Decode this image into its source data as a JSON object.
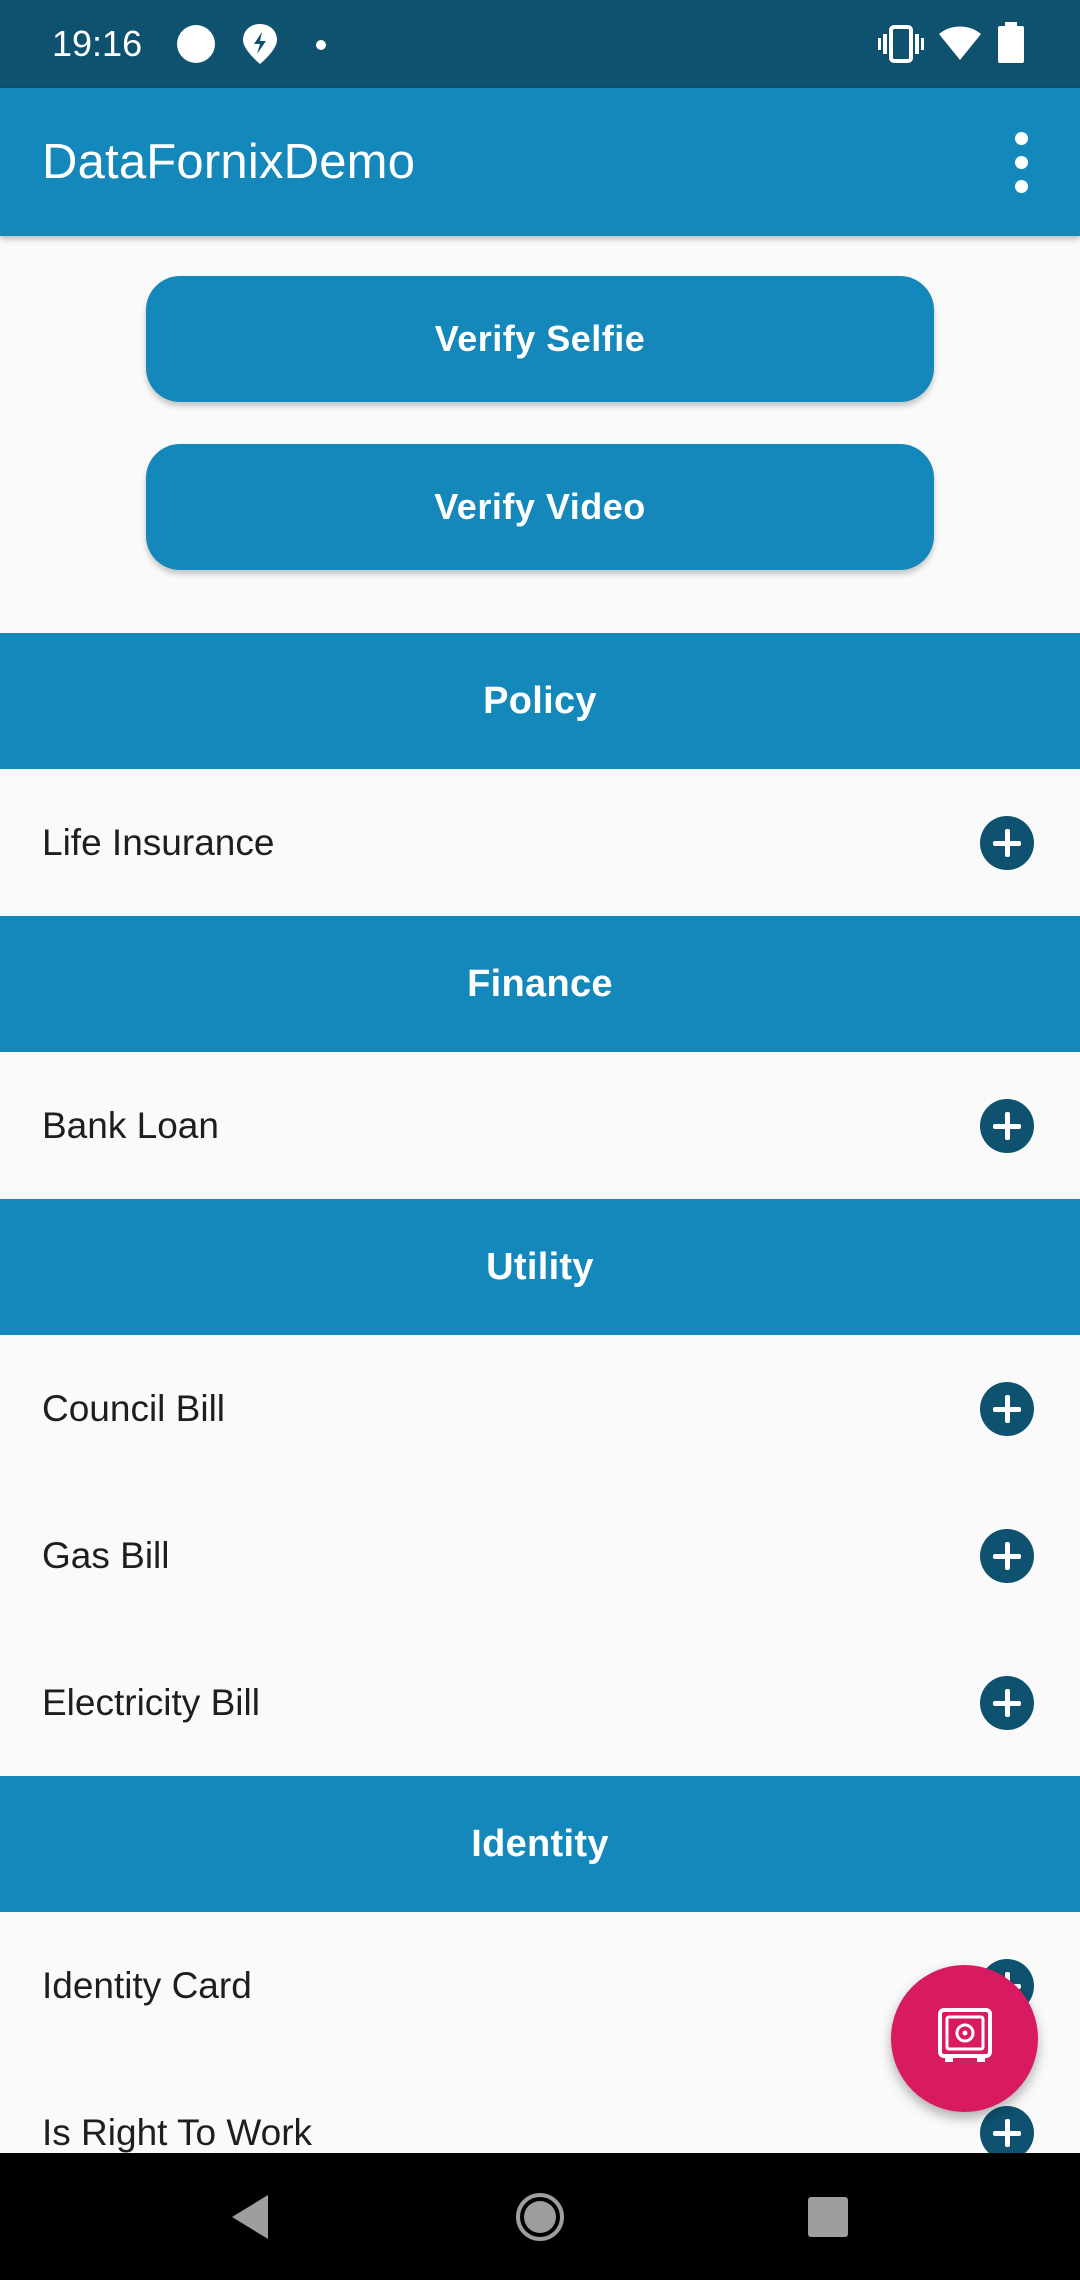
{
  "status_bar": {
    "time": "19:16",
    "icons": [
      "circle-notification-icon",
      "location-pin-icon",
      "dot-icon",
      "vibrate-icon",
      "wifi-icon",
      "battery-icon"
    ]
  },
  "app_bar": {
    "title": "DataFornixDemo",
    "menu_icon": "more-vert-icon"
  },
  "buttons": {
    "verify_selfie": "Verify Selfie",
    "verify_video": "Verify Video"
  },
  "sections": [
    {
      "title": "Policy",
      "items": [
        "Life Insurance"
      ]
    },
    {
      "title": "Finance",
      "items": [
        "Bank Loan"
      ]
    },
    {
      "title": "Utility",
      "items": [
        "Council Bill",
        "Gas Bill",
        "Electricity Bill"
      ]
    },
    {
      "title": "Identity",
      "items": [
        "Identity Card",
        "Is Right To Work"
      ]
    }
  ],
  "item_action_icon": "add-circle-icon",
  "fab": {
    "icon": "safe-vault-icon",
    "color": "#d81b60"
  },
  "colors": {
    "primary": "#1487bb",
    "primary_dark": "#0e526f",
    "accent": "#d81b60",
    "background": "#fafafa"
  },
  "nav_bar": {
    "icons": [
      "back-icon",
      "home-icon",
      "recents-icon"
    ]
  }
}
